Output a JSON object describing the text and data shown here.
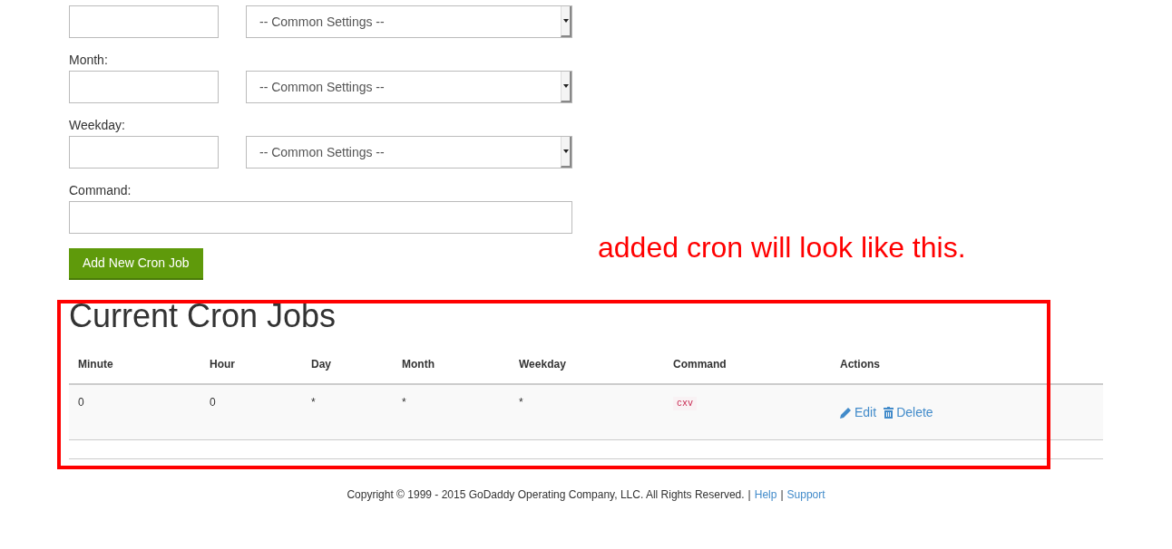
{
  "schedule_fields": [
    {
      "select": "-- Common Settings --"
    },
    {
      "label": "Month:",
      "select": "-- Common Settings --"
    },
    {
      "label": "Weekday:",
      "select": "-- Common Settings --"
    }
  ],
  "command": {
    "label": "Command:"
  },
  "add_button": "Add New Cron Job",
  "annotation": {
    "text": "added cron will look like this.",
    "color": "#ff0000"
  },
  "current_jobs": {
    "title": "Current Cron Jobs",
    "columns": [
      "Minute",
      "Hour",
      "Day",
      "Month",
      "Weekday",
      "Command",
      "Actions"
    ],
    "rows": [
      {
        "cells": [
          "0",
          "0",
          "*",
          "*",
          "*"
        ],
        "command": "cxv",
        "actions": [
          "Edit",
          "Delete"
        ]
      }
    ]
  },
  "footer": {
    "text": "Copyright © 1999 - 2015 GoDaddy Operating Company, LLC. All Rights Reserved.",
    "items": [
      {
        "kind": "separator",
        "text": "|"
      },
      {
        "kind": "link",
        "text": "Help"
      },
      {
        "kind": "separator",
        "text": "|"
      },
      {
        "kind": "link",
        "text": "Support"
      }
    ]
  }
}
